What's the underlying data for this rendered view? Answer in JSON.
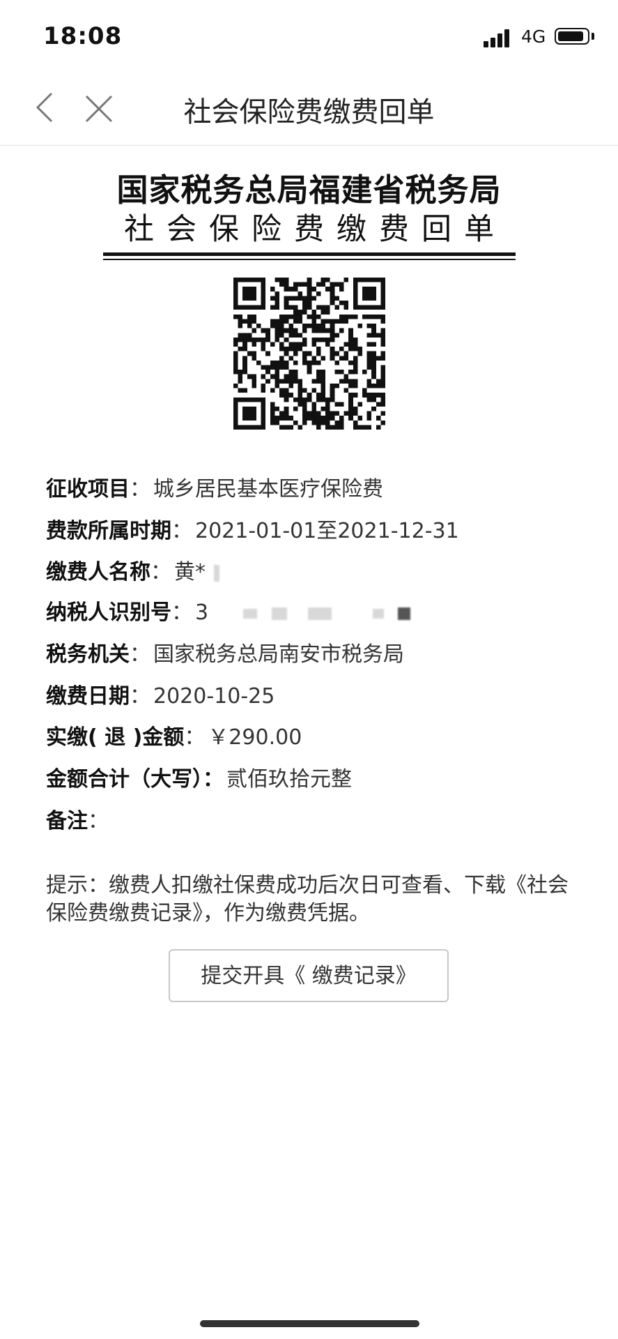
{
  "status_bar": {
    "time": "18:08",
    "network": "4G"
  },
  "nav": {
    "title": "社会保险费缴费回单"
  },
  "document": {
    "org": "国家税务总局福建省税务局",
    "title": "社会保险费缴费回单"
  },
  "fields": [
    {
      "label": "征收项目",
      "sep": "：",
      "value": "城乡居民基本医疗保险费"
    },
    {
      "label": "费款所属时期",
      "sep": "：",
      "value": "2021-01-01至2021-12-31"
    },
    {
      "label": "缴费人名称",
      "sep": "：",
      "value": "黄*"
    },
    {
      "label": "纳税人识别号",
      "sep": "：",
      "value": "3"
    },
    {
      "label": "税务机关",
      "sep": "：",
      "value": "国家税务总局南安市税务局"
    },
    {
      "label": "缴费日期",
      "sep": "：",
      "value": "2020-10-25"
    },
    {
      "label": "实缴( 退 )金额",
      "sep": "：",
      "value": "￥290.00"
    },
    {
      "label": "金额合计（大写）：",
      "sep": "",
      "value": "贰佰玖拾元整"
    },
    {
      "label": "备注",
      "sep": "：",
      "value": ""
    }
  ],
  "tip": "提示：缴费人扣缴社保费成功后次日可查看、下载《社会保险费缴费记录》，作为缴费凭据。",
  "submit_label": "提交开具《 缴费记录》",
  "icons": {
    "back": "chevron-left-icon",
    "close": "close-icon",
    "qr": "qr-code-icon"
  }
}
